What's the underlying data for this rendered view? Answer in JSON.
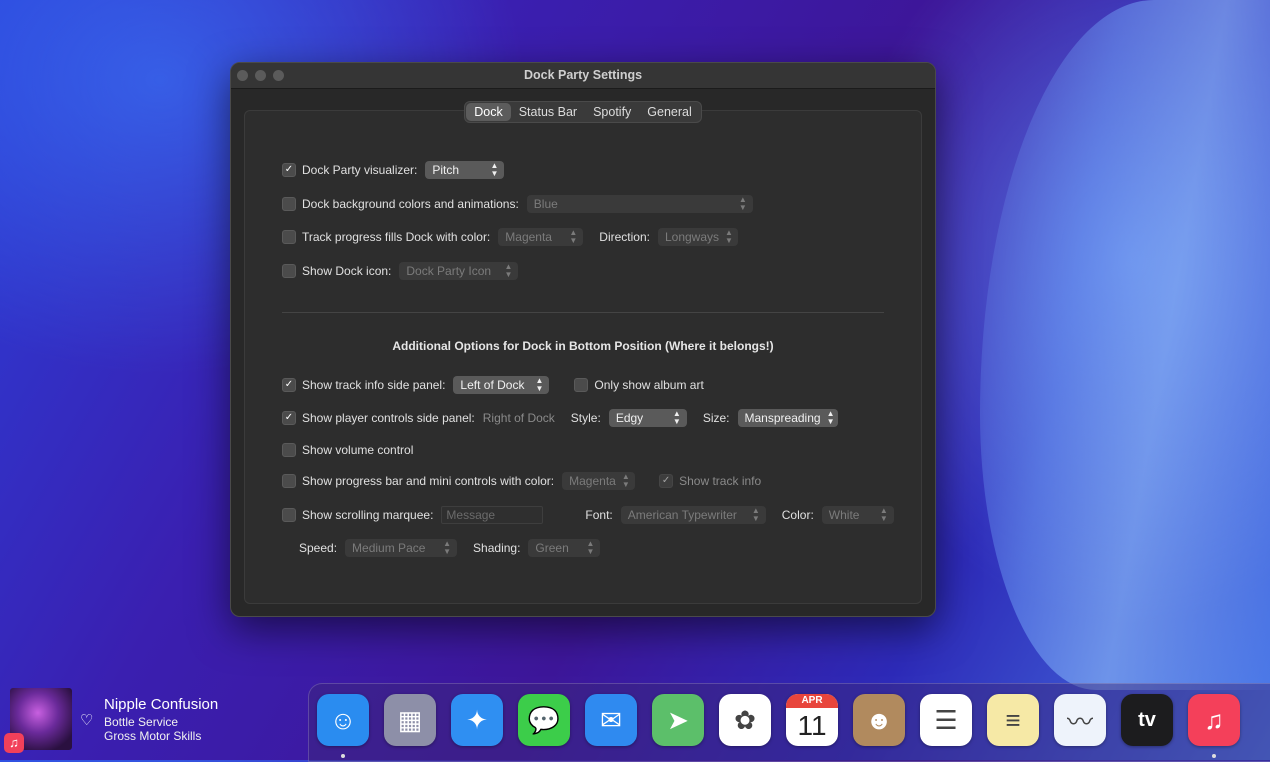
{
  "window": {
    "title": "Dock Party Settings",
    "tabs": [
      "Dock",
      "Status Bar",
      "Spotify",
      "General"
    ],
    "active_tab": "Dock"
  },
  "dock_settings": {
    "visualizer": {
      "label": "Dock Party visualizer:",
      "checked": true,
      "value": "Pitch"
    },
    "background": {
      "label": "Dock background colors and animations:",
      "checked": false,
      "value": "Blue"
    },
    "progress": {
      "label": "Track progress fills Dock with color:",
      "checked": false,
      "value": "Magenta",
      "direction_label": "Direction:",
      "direction_value": "Longways"
    },
    "dock_icon": {
      "label": "Show Dock icon:",
      "checked": false,
      "value": "Dock Party Icon"
    }
  },
  "additional": {
    "heading": "Additional Options for Dock in Bottom Position (Where it belongs!)",
    "track_info": {
      "label": "Show track info side panel:",
      "checked": true,
      "value": "Left of Dock",
      "album_art_label": "Only show album art",
      "album_art_checked": false
    },
    "player_controls": {
      "label": "Show player controls side panel:",
      "checked": true,
      "position_text": "Right of Dock",
      "style_label": "Style:",
      "style_value": "Edgy",
      "size_label": "Size:",
      "size_value": "Manspreading"
    },
    "volume": {
      "label": "Show volume control",
      "checked": false
    },
    "progress_bar": {
      "label": "Show progress bar and mini controls with color:",
      "checked": false,
      "value": "Magenta",
      "track_info_label": "Show track info",
      "track_info_checked": true
    },
    "marquee": {
      "label": "Show scrolling marquee:",
      "checked": false,
      "placeholder": "Message",
      "font_label": "Font:",
      "font_value": "American Typewriter",
      "color_label": "Color:",
      "color_value": "White"
    },
    "speed": {
      "label": "Speed:",
      "value": "Medium Pace",
      "shading_label": "Shading:",
      "shading_value": "Green"
    }
  },
  "now_playing": {
    "song": "Nipple Confusion",
    "artist": "Bottle Service",
    "album": "Gross Motor Skills"
  },
  "dock_apps": [
    {
      "name": "Finder",
      "glyph": "☺",
      "color": "#2a8cf0"
    },
    {
      "name": "Launchpad",
      "glyph": "▦",
      "color": "#8d8fa8"
    },
    {
      "name": "Safari",
      "glyph": "✦",
      "color": "#2f8ff2"
    },
    {
      "name": "Messages",
      "glyph": "💬",
      "color": "#3ccd4a"
    },
    {
      "name": "Mail",
      "glyph": "✉",
      "color": "#2f8af0"
    },
    {
      "name": "Maps",
      "glyph": "➤",
      "color": "#5cbf6a"
    },
    {
      "name": "Photos",
      "glyph": "✿",
      "color": "#ffffff"
    },
    {
      "name": "Calendar",
      "glyph": "",
      "color": "#ffffff",
      "month": "APR",
      "day": "11"
    },
    {
      "name": "Contacts",
      "glyph": "☻",
      "color": "#b18a5e"
    },
    {
      "name": "Reminders",
      "glyph": "☰",
      "color": "#ffffff"
    },
    {
      "name": "Notes",
      "glyph": "≡",
      "color": "#f6e9a6"
    },
    {
      "name": "Freeform",
      "glyph": "〰",
      "color": "#eef3fb"
    },
    {
      "name": "TV",
      "glyph": "tv",
      "color": "#1c1c1e"
    },
    {
      "name": "Music",
      "glyph": "♫",
      "color": "#f4405a"
    }
  ]
}
